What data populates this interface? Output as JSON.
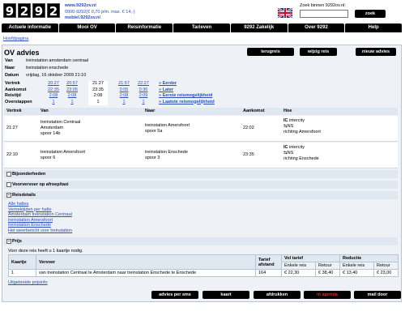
{
  "logo_digits": [
    "9",
    "2",
    "9",
    "2"
  ],
  "header_links": [
    "www.9292ov.nl",
    "0900-9292(€ 0,70 p/m. max. € 14,-)",
    "mobiel.9292ov.nl"
  ],
  "search": {
    "label": "Zoek binnen 9292ov.nl:",
    "value": "",
    "button": "zoek"
  },
  "nav": [
    "Actuele informatie",
    "Mooi OV",
    "Reisinformatie",
    "Tarieven",
    "9292 Zakelijk",
    "Over 9292",
    "Help"
  ],
  "breadcrumb": "Hoofdpagina",
  "page": {
    "title": "OV advies",
    "buttons": [
      "terugreis",
      "wijzig reis",
      "nieuw advies"
    ]
  },
  "journey": {
    "van_label": "Van",
    "van": "treinstation amsterdam centraal",
    "naar_label": "Naar",
    "naar": "treinstation enschede",
    "datum_label": "Datum",
    "datum": "vrijdag, 16 oktober 2009  21:10"
  },
  "times": {
    "labels": [
      "Vertrek",
      "Aankomst",
      "Reistijd",
      "Overstappen"
    ],
    "columns": [
      {
        "vertrek": "20:27",
        "aankomst": "22:35",
        "reistijd": "2:08",
        "overstappen": "1"
      },
      {
        "vertrek": "20:57",
        "aankomst": "23:05",
        "reistijd": "2:08",
        "overstappen": "1"
      },
      {
        "vertrek": "21:27",
        "aankomst": "23:35",
        "reistijd": "2:08",
        "overstappen": "1"
      },
      {
        "vertrek": "21:57",
        "aankomst": "0:05",
        "reistijd": "2:08",
        "overstappen": "1"
      },
      {
        "vertrek": "22:27",
        "aankomst": "0:36",
        "reistijd": "2:09",
        "overstappen": "1"
      }
    ],
    "more": [
      "» Eerder",
      "» Later",
      "» Eerste reismogelijkheid",
      "» Laatste reismogelijkheid"
    ]
  },
  "route": {
    "headers": [
      "Vertrek",
      "Van",
      "Naar",
      "Aankomst",
      "Hoe"
    ],
    "rows": [
      {
        "vertrek": "21:27",
        "van": [
          "treinstation Centraal",
          "Amsterdam",
          "spoor 14b"
        ],
        "naar": [
          "treinstation Amersfoort",
          "spoor 5a"
        ],
        "aankomst": "22:02",
        "hoe": [
          "IC",
          "intercity",
          "NS",
          "richting Amersfoort"
        ]
      },
      {
        "vertrek": "22:10",
        "van": [
          "treinstation Amersfoort",
          "spoor 6"
        ],
        "naar": [
          "treinstation Enschede",
          "spoor 3"
        ],
        "aankomst": "23:35",
        "hoe": [
          "IC",
          "intercity",
          "NS",
          "richting Enschede"
        ]
      }
    ]
  },
  "sections": {
    "bijzonderheden": "Bijzonderheden",
    "voorvervoer": "Voorvervoer op afroep/taxi",
    "reisdetails": "Reisdetails",
    "prijs": "Prijs"
  },
  "detail_links": [
    "Alle haltes",
    "Vertrektijden per halte",
    "Amsterdam treinstation Centraal",
    "treinstation Amersfoort",
    "treinstation Enschede",
    "Het weerbericht voor treinstation"
  ],
  "price": {
    "note": "Voor deze reis heeft u 1 kaartje nodig.",
    "headers": [
      "Kaartje",
      "Vervoer",
      "Tarief afstand",
      "Vol tarief",
      "Reductie"
    ],
    "subheaders": [
      "Enkele reis",
      "Retour",
      "Enkele reis",
      "Retour"
    ],
    "row": {
      "kaartje": "1",
      "vervoer": "van treinstation Centraal te Amsterdam naar treinstation Enschede te Enschede",
      "afstand": "164",
      "vol_enkel": "€ 22,30",
      "vol_retour": "€ 38,40",
      "red_enkel": "€ 13,40",
      "red_retour": "€ 23,00"
    },
    "more_link": "Uitgebreide prijsinfo"
  },
  "footer_buttons": [
    "advies per sms",
    "kaart",
    "afdrukken",
    "in agenda",
    "mail door"
  ]
}
